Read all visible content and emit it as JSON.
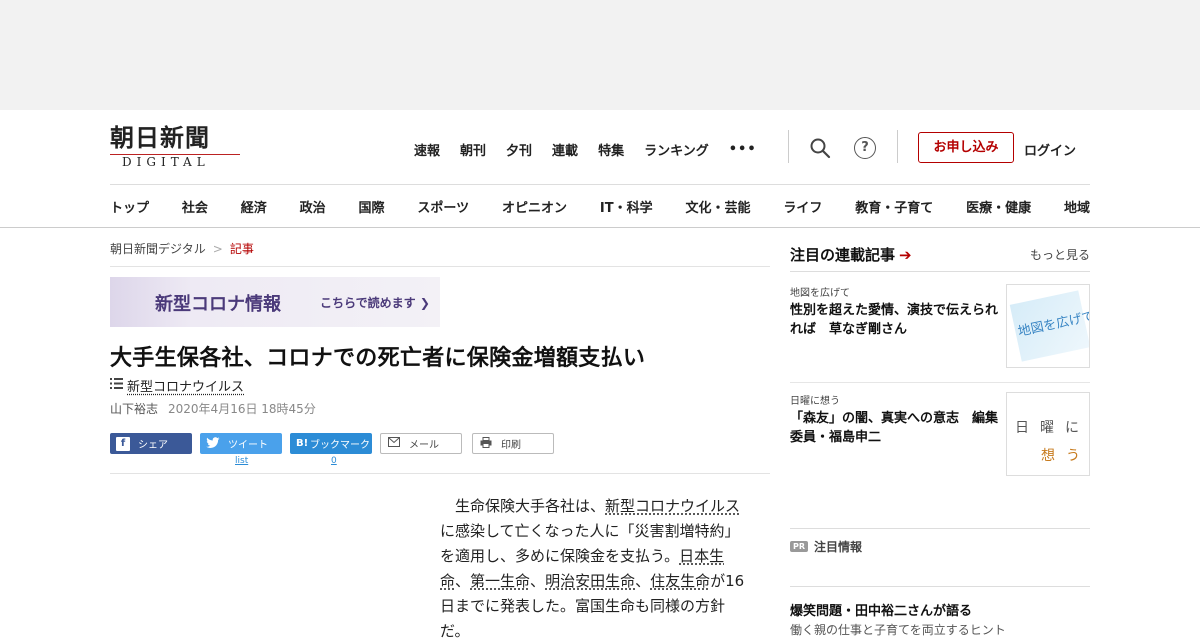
{
  "header": {
    "logo_main": "朝日新聞",
    "logo_sub": "DIGITAL",
    "top_nav": [
      "速報",
      "朝刊",
      "夕刊",
      "連載",
      "特集",
      "ランキング"
    ],
    "more_label": "•••",
    "help_label": "?",
    "subscribe_label": "お申し込み",
    "login_label": "ログイン",
    "categories": [
      "トップ",
      "社会",
      "経済",
      "政治",
      "国際",
      "スポーツ",
      "オピニオン",
      "IT・科学",
      "文化・芸能",
      "ライフ",
      "教育・子育て",
      "医療・健康",
      "地域"
    ]
  },
  "breadcrumb": {
    "home": "朝日新聞デジタル",
    "separator": ">",
    "current": "記事"
  },
  "banner": {
    "title": "新型コロナ情報",
    "link": "こちらで読めます"
  },
  "article": {
    "headline": "大手生保各社、コロナでの死亡者に保険金増額支払い",
    "topic": "新型コロナウイルス",
    "author": "山下裕志",
    "date": "2020年4月16日 18時45分",
    "body": {
      "p1a": "生命保険大手各社は、",
      "kw1": "新型コロナウイルス",
      "p1b": "に感染して亡くなった人に「災害割増特約」を適用し、多めに保険金を支払う。",
      "kw2": "日本生命",
      "sep1": "、",
      "kw3": "第一生命",
      "sep2": "、",
      "kw4": "明治安田生命",
      "sep3": "、",
      "kw5": "住友生命",
      "p1c": "が16日までに発表した。富国生命も同様の方針だ。"
    }
  },
  "share": {
    "facebook": "シェア",
    "twitter": "ツイート",
    "hatena": "ブックマーク",
    "mail": "メール",
    "print": "印刷",
    "twitter_count": "list",
    "hatena_count": "0"
  },
  "sidebar": {
    "title": "注目の連載記事",
    "more": "もっと見る",
    "items": [
      {
        "category": "地図を広げて",
        "title": "性別を超えた愛情、演技で伝えられれば　草なぎ剛さん",
        "thumb_text": "地図を広げて"
      },
      {
        "category": "日曜に想う",
        "title": "「森友」の闇、真実への意志　編集委員・福島申二",
        "thumb_text_1": "日曜に",
        "thumb_text_2": "想う"
      }
    ],
    "pr_badge": "PR",
    "pr_label": "注目情報",
    "pr_item_title": "爆笑問題・田中裕二さんが語る",
    "pr_item_sub": "働く親の仕事と子育てを両立するヒント"
  },
  "colors": {
    "brand_red": "#b40000",
    "facebook": "#3b5998",
    "twitter": "#4aa1eb",
    "hatena": "#2c8cd6"
  }
}
